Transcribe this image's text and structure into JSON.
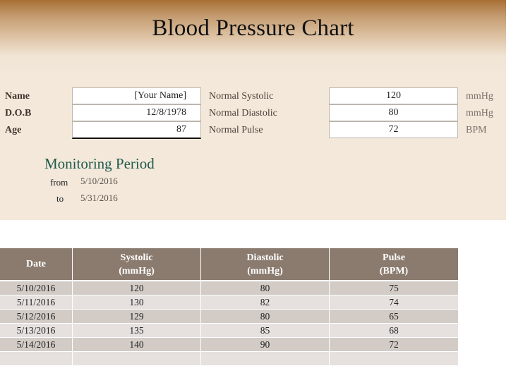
{
  "title": "Blood Pressure Chart",
  "patient": {
    "name_label": "Name",
    "name_value": "[Your Name]",
    "dob_label": "D.O.B",
    "dob_value": "12/8/1978",
    "age_label": "Age",
    "age_value": "87"
  },
  "normals": {
    "systolic_label": "Normal Systolic",
    "systolic_value": "120",
    "systolic_unit": "mmHg",
    "diastolic_label": "Normal Diastolic",
    "diastolic_value": "80",
    "diastolic_unit": "mmHg",
    "pulse_label": "Normal Pulse",
    "pulse_value": "72",
    "pulse_unit": "BPM"
  },
  "monitoring": {
    "title": "Monitoring Period",
    "from_label": "from",
    "from_value": "5/10/2016",
    "to_label": "to",
    "to_value": "5/31/2016"
  },
  "log": {
    "headers": [
      {
        "line1": "Date",
        "line2": ""
      },
      {
        "line1": "Systolic",
        "line2": "(mmHg)"
      },
      {
        "line1": "Diastolic",
        "line2": "(mmHg)"
      },
      {
        "line1": "Pulse",
        "line2": "(BPM)"
      }
    ],
    "rows": [
      {
        "date": "5/10/2016",
        "systolic": "120",
        "diastolic": "80",
        "pulse": "75"
      },
      {
        "date": "5/11/2016",
        "systolic": "130",
        "diastolic": "82",
        "pulse": "74"
      },
      {
        "date": "5/12/2016",
        "systolic": "129",
        "diastolic": "80",
        "pulse": "65"
      },
      {
        "date": "5/13/2016",
        "systolic": "135",
        "diastolic": "85",
        "pulse": "68"
      },
      {
        "date": "5/14/2016",
        "systolic": "140",
        "diastolic": "90",
        "pulse": "72"
      },
      {
        "date": "",
        "systolic": "",
        "diastolic": "",
        "pulse": ""
      }
    ]
  },
  "colors": {
    "banner_top": "#a86f34",
    "panel_bg": "#f3e8da",
    "header_bg": "#8b7b6f",
    "row_odd": "#d2cbc6",
    "row_even": "#e6e1de",
    "monitoring_title": "#1e5a4c"
  }
}
